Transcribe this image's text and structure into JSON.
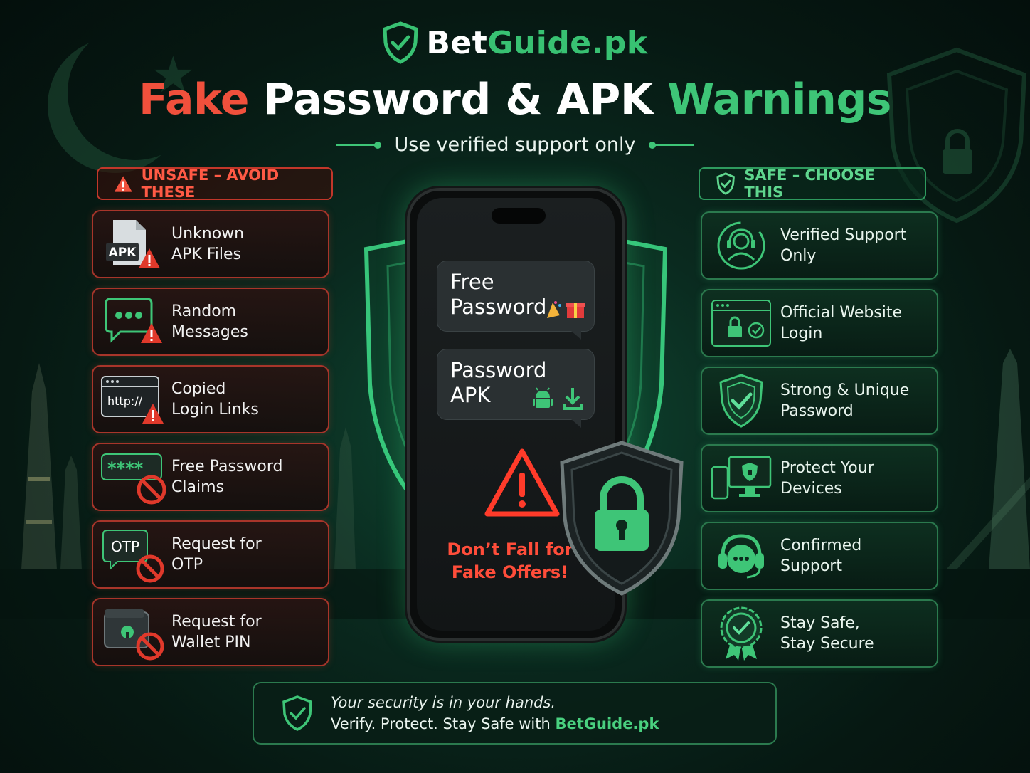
{
  "header": {
    "brand_part1": "Bet",
    "brand_part2": "Guide.pk",
    "title_red": "Fake",
    "title_white": "Password & APK",
    "title_green": "Warnings",
    "subtitle": "Use verified support only"
  },
  "unsafe": {
    "heading": "UNSAFE – AVOID THESE",
    "items": [
      {
        "label": "Unknown\nAPK Files",
        "icon": "apk-file-warning-icon",
        "icon_text": "APK"
      },
      {
        "label": "Random\nMessages",
        "icon": "chat-bubble-warning-icon"
      },
      {
        "label": "Copied\nLogin Links",
        "icon": "browser-link-warning-icon",
        "icon_text": "http://"
      },
      {
        "label": "Free Password\nClaims",
        "icon": "password-blocked-icon",
        "icon_text": "****"
      },
      {
        "label": "Request for\nOTP",
        "icon": "otp-blocked-icon",
        "icon_text": "OTP"
      },
      {
        "label": "Request for\nWallet PIN",
        "icon": "wallet-pin-blocked-icon"
      }
    ]
  },
  "safe": {
    "heading": "SAFE – CHOOSE THIS",
    "items": [
      {
        "label": "Verified Support\nOnly",
        "icon": "support-agent-icon"
      },
      {
        "label": "Official Website\nLogin",
        "icon": "secure-browser-icon"
      },
      {
        "label": "Strong & Unique\nPassword",
        "icon": "shield-check-icon"
      },
      {
        "label": "Protect Your\nDevices",
        "icon": "devices-shield-icon"
      },
      {
        "label": "Confirmed\nSupport",
        "icon": "headset-chat-icon"
      },
      {
        "label": "Stay Safe,\nStay Secure",
        "icon": "badge-check-icon"
      }
    ]
  },
  "phone": {
    "bubble1": "Free\nPassword",
    "bubble2": "Password\nAPK",
    "warning": "Don’t Fall for\nFake Offers!"
  },
  "footer": {
    "line1": "Your security is in your hands.",
    "line2": "Verify. Protect. Stay Safe with ",
    "brand": "BetGuide.pk"
  },
  "colors": {
    "red": "#f0503c",
    "green": "#3ec577",
    "background": "#061812"
  }
}
